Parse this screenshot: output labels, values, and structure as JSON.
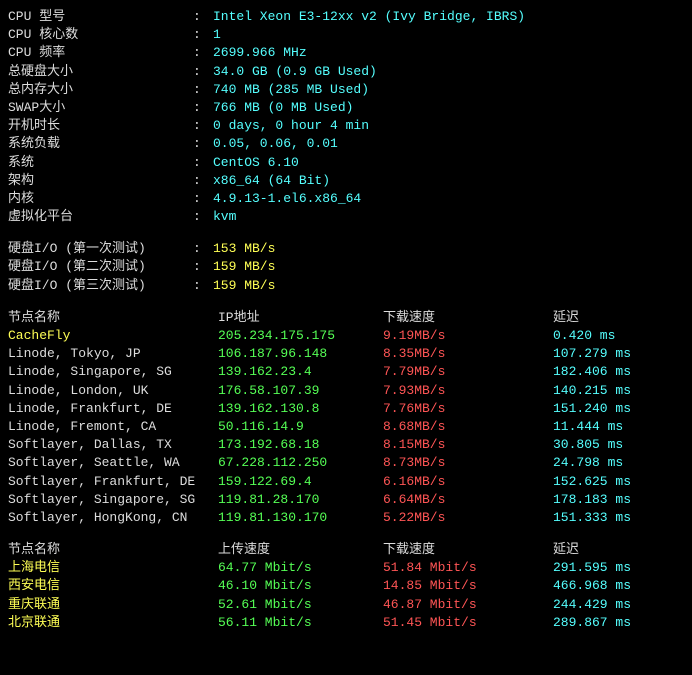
{
  "sysinfo": [
    {
      "label": "CPU 型号",
      "value": "Intel Xeon E3-12xx v2 (Ivy Bridge, IBRS)"
    },
    {
      "label": "CPU 核心数",
      "value": "1"
    },
    {
      "label": "CPU 频率",
      "value": "2699.966 MHz"
    },
    {
      "label": "总硬盘大小",
      "value": "34.0 GB (0.9 GB Used)"
    },
    {
      "label": "总内存大小",
      "value": "740 MB (285 MB Used)"
    },
    {
      "label": "SWAP大小",
      "value": "766 MB (0 MB Used)"
    },
    {
      "label": "开机时长",
      "value": "0 days, 0 hour 4 min"
    },
    {
      "label": "系统负载",
      "value": "0.05, 0.06, 0.01"
    },
    {
      "label": "系统",
      "value": "CentOS 6.10"
    },
    {
      "label": "架构",
      "value": "x86_64 (64 Bit)"
    },
    {
      "label": "内核",
      "value": "4.9.13-1.el6.x86_64"
    },
    {
      "label": "虚拟化平台",
      "value": "kvm"
    }
  ],
  "diskio": [
    {
      "label": "硬盘I/O (第一次测试)",
      "value": "153 MB/s"
    },
    {
      "label": "硬盘I/O (第二次测试)",
      "value": "159 MB/s"
    },
    {
      "label": "硬盘I/O (第三次测试)",
      "value": "159 MB/s"
    }
  ],
  "speed_headers": {
    "node": "节点名称",
    "ip": "IP地址",
    "dl": "下载速度",
    "lat": "延迟"
  },
  "speedtest": [
    {
      "node": "CacheFly",
      "ip": "205.234.175.175",
      "dl": "9.19MB/s",
      "lat": "0.420 ms",
      "node_class": "c-yellow"
    },
    {
      "node": "Linode, Tokyo, JP",
      "ip": "106.187.96.148",
      "dl": "8.35MB/s",
      "lat": "107.279 ms",
      "node_class": "c-white"
    },
    {
      "node": "Linode, Singapore, SG",
      "ip": "139.162.23.4",
      "dl": "7.79MB/s",
      "lat": "182.406 ms",
      "node_class": "c-white"
    },
    {
      "node": "Linode, London, UK",
      "ip": "176.58.107.39",
      "dl": "7.93MB/s",
      "lat": "140.215 ms",
      "node_class": "c-white"
    },
    {
      "node": "Linode, Frankfurt, DE",
      "ip": "139.162.130.8",
      "dl": "7.76MB/s",
      "lat": "151.240 ms",
      "node_class": "c-white"
    },
    {
      "node": "Linode, Fremont, CA",
      "ip": "50.116.14.9",
      "dl": "8.68MB/s",
      "lat": "11.444 ms",
      "node_class": "c-white"
    },
    {
      "node": "Softlayer, Dallas, TX",
      "ip": "173.192.68.18",
      "dl": "8.15MB/s",
      "lat": "30.805 ms",
      "node_class": "c-white"
    },
    {
      "node": "Softlayer, Seattle, WA",
      "ip": "67.228.112.250",
      "dl": "8.73MB/s",
      "lat": "24.798 ms",
      "node_class": "c-white"
    },
    {
      "node": "Softlayer, Frankfurt, DE",
      "ip": "159.122.69.4",
      "dl": "6.16MB/s",
      "lat": "152.625 ms",
      "node_class": "c-white"
    },
    {
      "node": "Softlayer, Singapore, SG",
      "ip": "119.81.28.170",
      "dl": "6.64MB/s",
      "lat": "178.183 ms",
      "node_class": "c-white"
    },
    {
      "node": "Softlayer, HongKong, CN",
      "ip": "119.81.130.170",
      "dl": "5.22MB/s",
      "lat": "151.333 ms",
      "node_class": "c-white"
    }
  ],
  "china_headers": {
    "node": "节点名称",
    "up": "上传速度",
    "dl": "下载速度",
    "lat": "延迟"
  },
  "china_speedtest": [
    {
      "node": "上海电信",
      "up": "64.77 Mbit/s",
      "dl": "51.84 Mbit/s",
      "lat": "291.595 ms"
    },
    {
      "node": "西安电信",
      "up": "46.10 Mbit/s",
      "dl": "14.85 Mbit/s",
      "lat": "466.968 ms"
    },
    {
      "node": "重庆联通",
      "up": "52.61 Mbit/s",
      "dl": "46.87 Mbit/s",
      "lat": "244.429 ms"
    },
    {
      "node": "北京联通",
      "up": "56.11 Mbit/s",
      "dl": "51.45 Mbit/s",
      "lat": "289.867 ms"
    }
  ]
}
